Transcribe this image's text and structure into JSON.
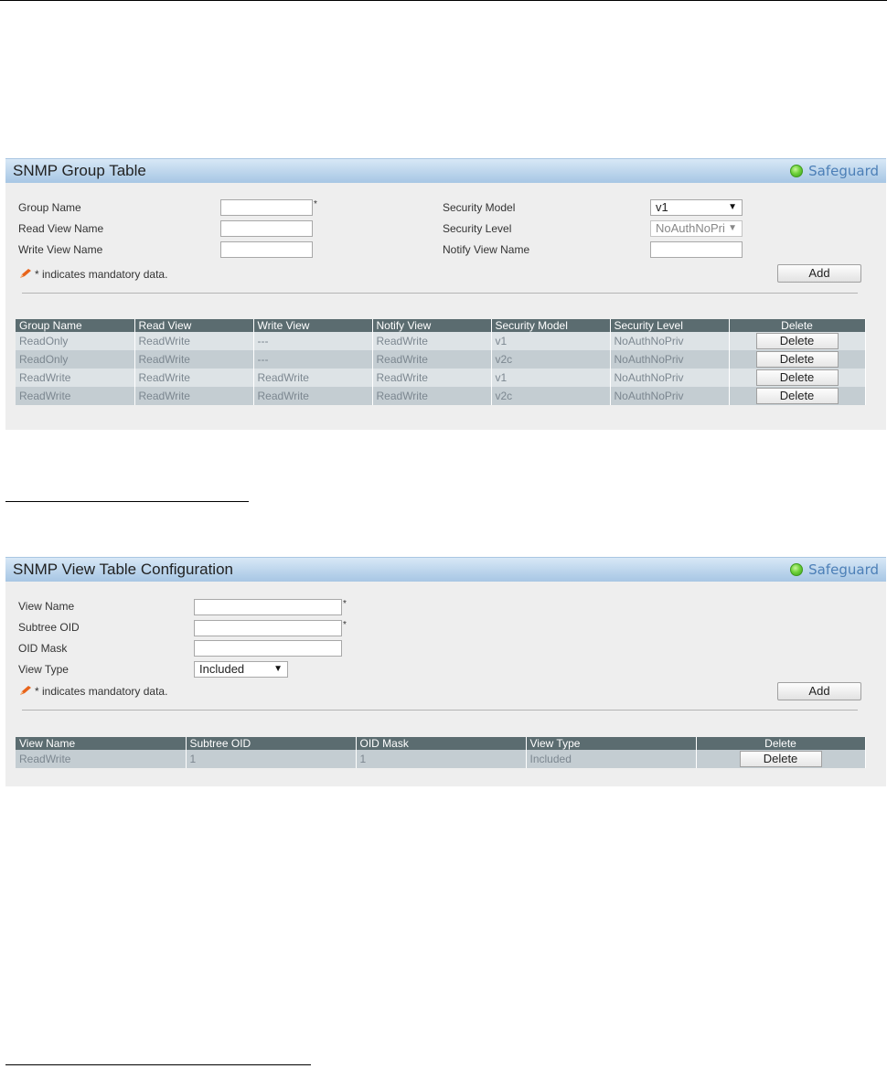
{
  "group_panel": {
    "title": "SNMP Group Table",
    "safeguard_label": "Safeguard",
    "fields": {
      "group_name_label": "Group Name",
      "read_view_label": "Read View Name",
      "write_view_label": "Write View Name",
      "security_model_label": "Security Model",
      "security_level_label": "Security Level",
      "notify_view_label": "Notify View Name",
      "group_name_value": "",
      "read_view_value": "",
      "write_view_value": "",
      "notify_view_value": "",
      "security_model_value": "v1",
      "security_level_value": "NoAuthNoPri",
      "required_marker": "*"
    },
    "mandatory_note": "* indicates mandatory data.",
    "add_label": "Add",
    "table": {
      "headers": [
        "Group Name",
        "Read View",
        "Write View",
        "Notify View",
        "Security Model",
        "Security Level",
        "Delete"
      ],
      "rows": [
        {
          "group_name": "ReadOnly",
          "read_view": "ReadWrite",
          "write_view": "---",
          "notify_view": "ReadWrite",
          "security_model": "v1",
          "security_level": "NoAuthNoPriv",
          "delete_label": "Delete"
        },
        {
          "group_name": "ReadOnly",
          "read_view": "ReadWrite",
          "write_view": "---",
          "notify_view": "ReadWrite",
          "security_model": "v2c",
          "security_level": "NoAuthNoPriv",
          "delete_label": "Delete"
        },
        {
          "group_name": "ReadWrite",
          "read_view": "ReadWrite",
          "write_view": "ReadWrite",
          "notify_view": "ReadWrite",
          "security_model": "v1",
          "security_level": "NoAuthNoPriv",
          "delete_label": "Delete"
        },
        {
          "group_name": "ReadWrite",
          "read_view": "ReadWrite",
          "write_view": "ReadWrite",
          "notify_view": "ReadWrite",
          "security_model": "v2c",
          "security_level": "NoAuthNoPriv",
          "delete_label": "Delete"
        }
      ]
    }
  },
  "view_panel": {
    "title": "SNMP View Table Configuration",
    "safeguard_label": "Safeguard",
    "fields": {
      "view_name_label": "View Name",
      "subtree_oid_label": "Subtree OID",
      "oid_mask_label": "OID Mask",
      "view_type_label": "View Type",
      "view_name_value": "",
      "subtree_oid_value": "",
      "oid_mask_value": "",
      "view_type_value": "Included",
      "required_marker": "*"
    },
    "mandatory_note": "* indicates mandatory data.",
    "add_label": "Add",
    "table": {
      "headers": [
        "View Name",
        "Subtree OID",
        "OID Mask",
        "View Type",
        "Delete"
      ],
      "rows": [
        {
          "view_name": "ReadWrite",
          "subtree_oid": "1",
          "oid_mask": "1",
          "view_type": "Included",
          "delete_label": "Delete"
        }
      ]
    }
  },
  "colors": {
    "header_gradient_top": "#d8e8f6",
    "header_gradient_bottom": "#a7c6e4",
    "table_header": "#5b6c70",
    "row_light": "#dde3e6",
    "row_dark": "#c4cdd2",
    "safeguard_green": "#6fd23a",
    "safeguard_text": "#4c7fb7"
  },
  "icons": {
    "safeguard": "green-circle-icon",
    "mandatory": "pencil-icon",
    "dropdown": "triangle-down"
  }
}
